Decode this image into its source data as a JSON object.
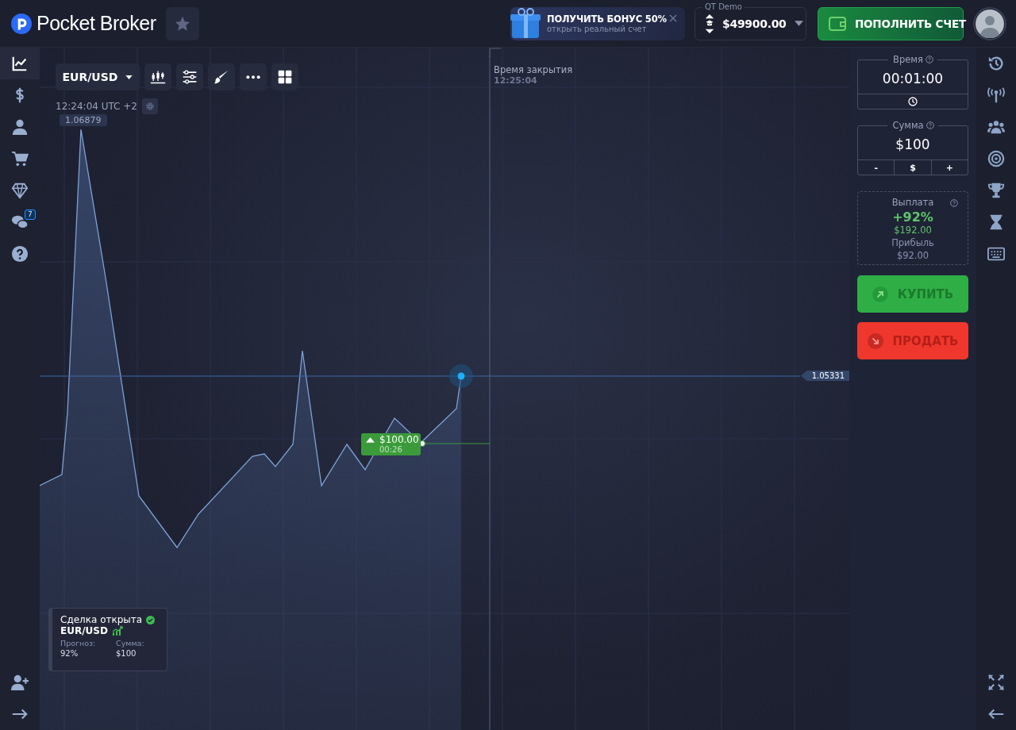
{
  "header": {
    "logo": "Pocket Broker",
    "bonus": {
      "title": "ПОЛУЧИТЬ БОНУС 50%",
      "subtitle": "открыть реальный счет"
    },
    "account": {
      "label": "QT Demo",
      "balance": "$49900.00"
    },
    "deposit_button": "ПОПОЛНИТЬ СЧЕТ"
  },
  "left_sidebar": {
    "items": [
      {
        "selected": true
      },
      {
        "selected": false
      },
      {
        "selected": false
      },
      {
        "selected": false
      },
      {
        "selected": false
      },
      {
        "selected": false,
        "badge": "7"
      },
      {
        "selected": false
      }
    ]
  },
  "chart": {
    "pair": "EUR/USD",
    "clock": "12:24:04 UTC +2",
    "high_label": "1.06879",
    "current_price": "1.05331",
    "expiry": {
      "label": "Время закрытия",
      "time": "12:25:04"
    },
    "trade_marker": {
      "amount": "$100.00",
      "timer": "00:26"
    },
    "trade_notice": {
      "title": "Сделка открыта",
      "pair": "EUR/USD",
      "forecast_label": "Прогноз:",
      "forecast": "92%",
      "sum_label": "Сумма:",
      "sum": "$100"
    }
  },
  "trade_panel": {
    "time": {
      "label": "Время",
      "value": "00:01:00"
    },
    "amount": {
      "label": "Сумма",
      "value": "$100",
      "buttons": [
        "-",
        "$",
        "+"
      ]
    },
    "payout": {
      "label": "Выплата",
      "percent": "+92%",
      "payout": "$192.00",
      "profit_label": "Прибыль",
      "profit": "$92.00"
    },
    "buy_button": "КУПИТЬ",
    "sell_button": "ПРОДАТЬ"
  }
}
